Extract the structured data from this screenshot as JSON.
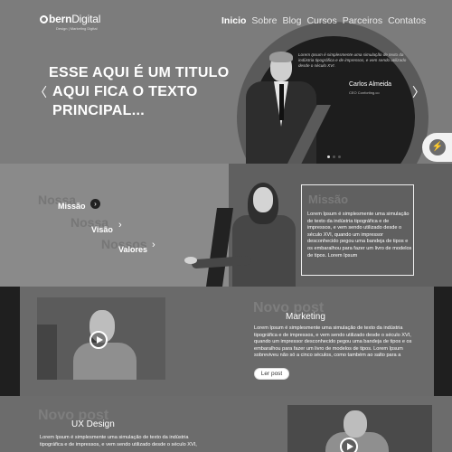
{
  "brand": {
    "logo_text_bold": "bern",
    "logo_text_light": "Digital",
    "tagline": "Design | Marketing Digital"
  },
  "nav": {
    "items": [
      "Inicio",
      "Sobre",
      "Blog",
      "Cursos",
      "Parceiros",
      "Contatos"
    ],
    "active": "Inicio"
  },
  "hero": {
    "title_lines": [
      "ESSE AQUI É UM TITULO",
      "AQUI FICA O TEXTO",
      "PRINCIPAL..."
    ],
    "prev_icon": "chevron-left-icon",
    "next_icon": "chevron-right-icon",
    "testimonial": {
      "quote": "Lorem Ipsum é simplesmente uma simulação de texto da indústria tipográfica e de impressos, e vem sendo utilizado desde o século XVI.",
      "name": "Carlos Almeida",
      "role": "CEO Conforting.co"
    },
    "slides_total": 3,
    "slide_active": 1
  },
  "messenger": {
    "icon": "messenger-icon"
  },
  "mission": {
    "ghost_words": [
      "Nossa",
      "Nossa",
      "Nossos"
    ],
    "tabs": [
      "Missão",
      "Visão",
      "Valores"
    ],
    "active_tab": "Missão",
    "panel_title": "Missão",
    "panel_text": "Lorem Ipsum é simplesmente uma simulação de texto da indústria tipográfica e de impressos, e vem sendo utilizado desde o século XVI, quando um impressor desconhecido pegou uma bandeja de tipos e os embaralhou para fazer um livro de modelos de tipos. Lorem Ipsum"
  },
  "posts": [
    {
      "ghost": "Novo post",
      "category": "Marketing",
      "text": "Lorem Ipsum é simplesmente uma simulação de texto da indústria tipográfica e de impressos, e vem sendo utilizado desde o século XVI, quando um impressor desconhecido pegou uma bandeja de tipos e os embaralhou para fazer um livro de modelos de tipos. Lorem Ipsum sobreviveu não só a cinco séculos, como também ao salto para a",
      "button": "Ler post"
    },
    {
      "ghost": "Novo post",
      "category": "UX Design",
      "text": "Lorem Ipsum é simplesmente uma simulação de texto da indústria tipográfica e de impressos, e vem sendo utilizado desde o século XVI,"
    }
  ],
  "colors": {
    "hero_bg": "#7c7c7c",
    "dark_circle": "#1d1d1d",
    "section_gray": "#8a8a8a",
    "panel_dark": "#606060"
  }
}
